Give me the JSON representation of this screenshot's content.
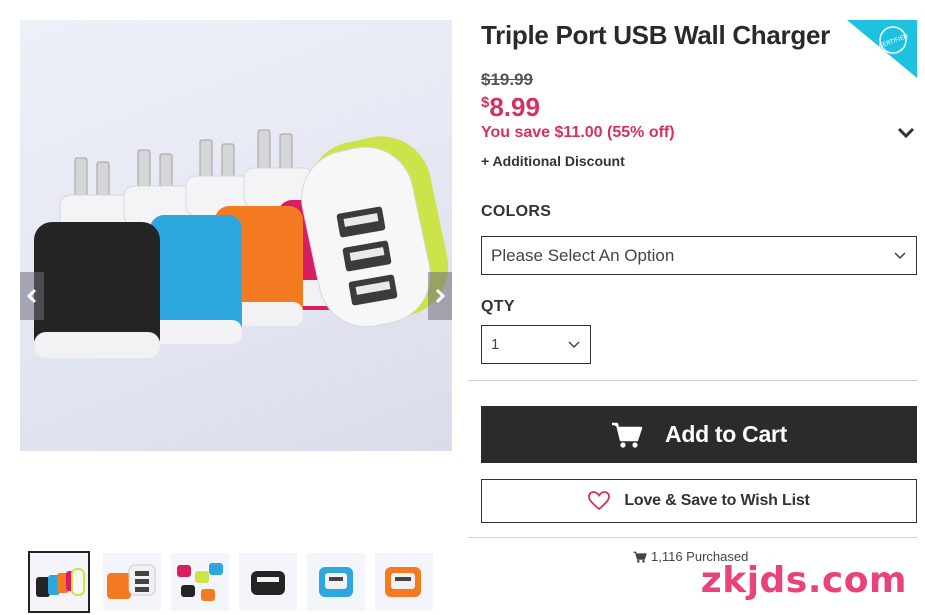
{
  "product": {
    "title": "Triple Port USB Wall Charger",
    "badge_text": "CERTIFIED",
    "old_price": "$19.99",
    "price_currency": "$",
    "price_amount": "8.99",
    "savings": "You save $11.00 (55% off)",
    "additional_discount": "+ Additional Discount"
  },
  "options": {
    "colors_label": "COLORS",
    "colors_value": "Please Select An Option",
    "qty_label": "QTY",
    "qty_value": "1"
  },
  "actions": {
    "add_to_cart": "Add to Cart",
    "wishlist": "Love & Save to Wish List"
  },
  "stats": {
    "purchased": "1,116 Purchased"
  },
  "gallery": {
    "image_subject": "usb-wall-chargers-photo",
    "thumbnail_count": 6,
    "active_thumbnail": 1
  },
  "watermark": "zkjds.com",
  "colors": {
    "accent_pink": "#d6305e",
    "badge_cyan": "#1fc1e0",
    "button_dark": "#2b2b2d",
    "watermark_pink": "#e8437a"
  },
  "icons": [
    "chevron-left-icon",
    "chevron-right-icon",
    "chevron-down-icon",
    "cart-icon",
    "heart-icon"
  ]
}
